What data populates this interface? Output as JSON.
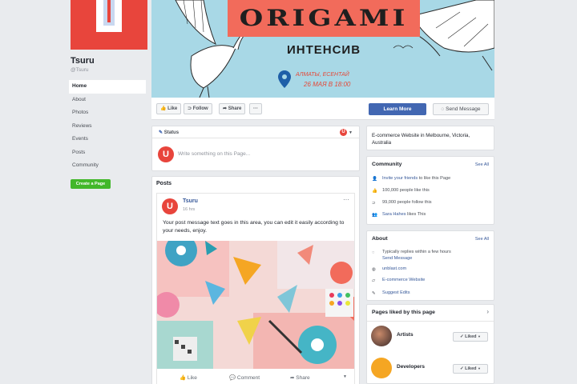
{
  "page": {
    "name": "Tsuru",
    "handle": "@Tsuru",
    "avatar_letter": "U"
  },
  "nav": {
    "items": [
      "Home",
      "About",
      "Photos",
      "Reviews",
      "Events",
      "Posts",
      "Community"
    ],
    "create_label": "Create a Page"
  },
  "cover": {
    "title": "ORIGAMI",
    "subtitle": "ИНТЕНСИВ",
    "location": "АЛМАТЫ, ЕСЕНТАЙ",
    "date": "26 МАЯ В 18:00"
  },
  "actions": {
    "like": "Like",
    "follow": "Follow",
    "share": "Share",
    "more": "···",
    "learn_more": "Learn More",
    "send_message": "Send Message"
  },
  "status": {
    "tab": "Status",
    "placeholder": "Write something on this Page..."
  },
  "posts": {
    "heading": "Posts",
    "author": "Tsuru",
    "time": "16 hrs",
    "text": "Your post message text goes in this area, you can edit it easily according to your needs, enjoy.",
    "like": "Like",
    "comment": "Comment",
    "share": "Share"
  },
  "right": {
    "category": "E-commerce Website in Melbourne, Victoria, Australia",
    "community": {
      "title": "Community",
      "see_all": "See All",
      "invite_link": "Invite your friends",
      "invite_rest": " to like this Page",
      "likes": "100,000 people like this",
      "follows": "99,000 people follow this",
      "friend_name": "Sara Hahes",
      "friend_rest": " likes This"
    },
    "about": {
      "title": "About",
      "see_all": "See All",
      "reply": "Typically replies within a few hours",
      "send_message": "Send Message",
      "website_short": "unblast.com",
      "category_link": "E-commerce Website",
      "suggest": "Suggest Edits"
    },
    "pages_liked": {
      "title": "Pages liked by this page",
      "items": [
        {
          "name": "Artists",
          "button": "Liked"
        },
        {
          "name": "Developers",
          "button": "Liked"
        }
      ]
    }
  },
  "colors": {
    "brand_red": "#e8453c",
    "fb_blue": "#4267b2",
    "link_blue": "#365899",
    "green": "#42b72a",
    "cover_sky": "#a8d8e6"
  }
}
